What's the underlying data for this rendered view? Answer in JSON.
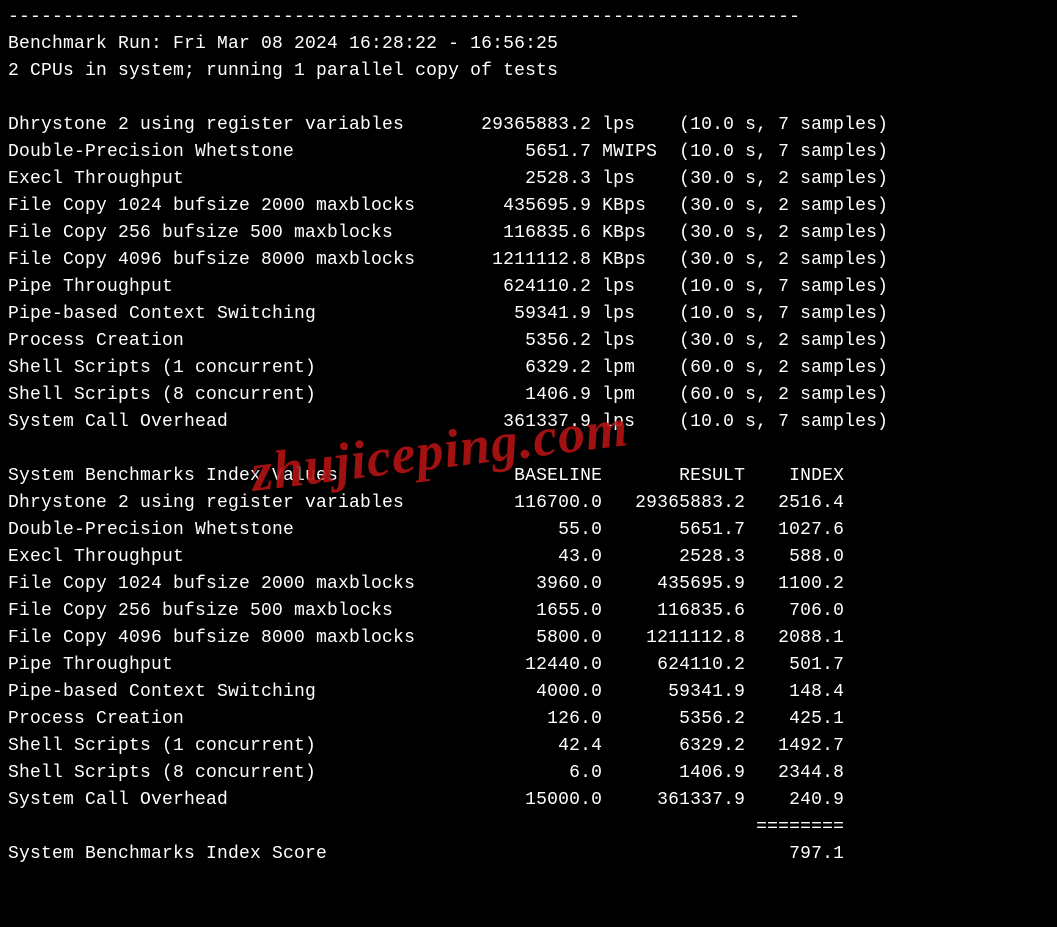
{
  "dash_line": "------------------------------------------------------------------------",
  "run_line": "Benchmark Run: Fri Mar 08 2024 16:28:22 - 16:56:25",
  "cpu_line": "2 CPUs in system; running 1 parallel copy of tests",
  "tests": [
    {
      "name": "Dhrystone 2 using register variables",
      "value": "29365883.2",
      "unit": "lps",
      "timing": "(10.0 s, 7 samples)"
    },
    {
      "name": "Double-Precision Whetstone",
      "value": "5651.7",
      "unit": "MWIPS",
      "timing": "(10.0 s, 7 samples)"
    },
    {
      "name": "Execl Throughput",
      "value": "2528.3",
      "unit": "lps",
      "timing": "(30.0 s, 2 samples)"
    },
    {
      "name": "File Copy 1024 bufsize 2000 maxblocks",
      "value": "435695.9",
      "unit": "KBps",
      "timing": "(30.0 s, 2 samples)"
    },
    {
      "name": "File Copy 256 bufsize 500 maxblocks",
      "value": "116835.6",
      "unit": "KBps",
      "timing": "(30.0 s, 2 samples)"
    },
    {
      "name": "File Copy 4096 bufsize 8000 maxblocks",
      "value": "1211112.8",
      "unit": "KBps",
      "timing": "(30.0 s, 2 samples)"
    },
    {
      "name": "Pipe Throughput",
      "value": "624110.2",
      "unit": "lps",
      "timing": "(10.0 s, 7 samples)"
    },
    {
      "name": "Pipe-based Context Switching",
      "value": "59341.9",
      "unit": "lps",
      "timing": "(10.0 s, 7 samples)"
    },
    {
      "name": "Process Creation",
      "value": "5356.2",
      "unit": "lps",
      "timing": "(30.0 s, 2 samples)"
    },
    {
      "name": "Shell Scripts (1 concurrent)",
      "value": "6329.2",
      "unit": "lpm",
      "timing": "(60.0 s, 2 samples)"
    },
    {
      "name": "Shell Scripts (8 concurrent)",
      "value": "1406.9",
      "unit": "lpm",
      "timing": "(60.0 s, 2 samples)"
    },
    {
      "name": "System Call Overhead",
      "value": "361337.9",
      "unit": "lps",
      "timing": "(10.0 s, 7 samples)"
    }
  ],
  "index_header": {
    "name": "System Benchmarks Index Values",
    "baseline": "BASELINE",
    "result": "RESULT",
    "index": "INDEX"
  },
  "index_rows": [
    {
      "name": "Dhrystone 2 using register variables",
      "baseline": "116700.0",
      "result": "29365883.2",
      "index": "2516.4"
    },
    {
      "name": "Double-Precision Whetstone",
      "baseline": "55.0",
      "result": "5651.7",
      "index": "1027.6"
    },
    {
      "name": "Execl Throughput",
      "baseline": "43.0",
      "result": "2528.3",
      "index": "588.0"
    },
    {
      "name": "File Copy 1024 bufsize 2000 maxblocks",
      "baseline": "3960.0",
      "result": "435695.9",
      "index": "1100.2"
    },
    {
      "name": "File Copy 256 bufsize 500 maxblocks",
      "baseline": "1655.0",
      "result": "116835.6",
      "index": "706.0"
    },
    {
      "name": "File Copy 4096 bufsize 8000 maxblocks",
      "baseline": "5800.0",
      "result": "1211112.8",
      "index": "2088.1"
    },
    {
      "name": "Pipe Throughput",
      "baseline": "12440.0",
      "result": "624110.2",
      "index": "501.7"
    },
    {
      "name": "Pipe-based Context Switching",
      "baseline": "4000.0",
      "result": "59341.9",
      "index": "148.4"
    },
    {
      "name": "Process Creation",
      "baseline": "126.0",
      "result": "5356.2",
      "index": "425.1"
    },
    {
      "name": "Shell Scripts (1 concurrent)",
      "baseline": "42.4",
      "result": "6329.2",
      "index": "1492.7"
    },
    {
      "name": "Shell Scripts (8 concurrent)",
      "baseline": "6.0",
      "result": "1406.9",
      "index": "2344.8"
    },
    {
      "name": "System Call Overhead",
      "baseline": "15000.0",
      "result": "361337.9",
      "index": "240.9"
    }
  ],
  "score_sep": "========",
  "score_label": "System Benchmarks Index Score",
  "score_value": "797.1",
  "watermark": "zhujiceping.com"
}
